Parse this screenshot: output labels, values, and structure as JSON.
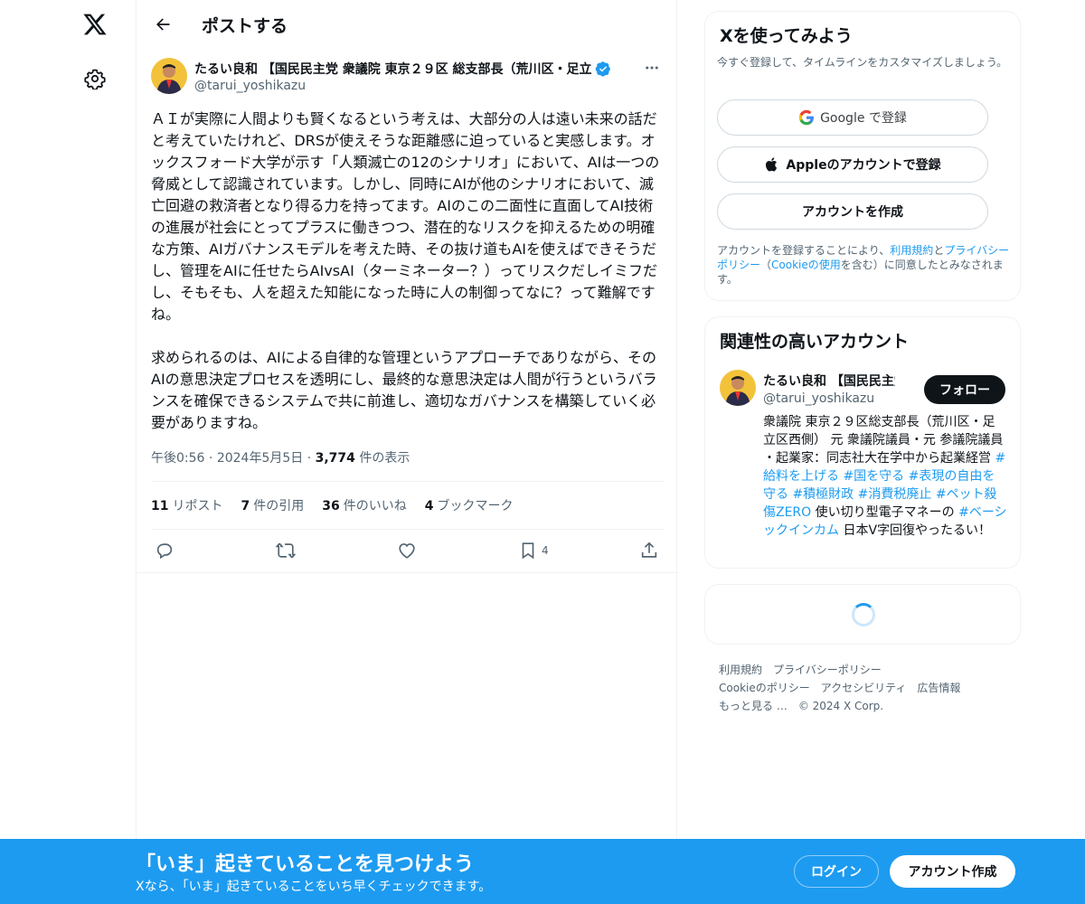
{
  "nav": {
    "logo_icon": "x-logo-icon",
    "settings_icon": "gear-icon"
  },
  "header": {
    "title": "ポストする"
  },
  "tweet": {
    "author_name": "たるい良和 【国民民主党 衆議院 東京２９区 総支部長（荒川区・足立",
    "author_handle": "@tarui_yoshikazu",
    "text": "ＡＩが実際に人間よりも賢くなるという考えは、大部分の人は遠い未来の話だと考えていたけれど、DRSが使えそうな距離感に迫っていると実感します。オックスフォード大学が示す「人類滅亡の12のシナリオ」において、AIは一つの脅威として認識されています。しかし、同時にAIが他のシナリオにおいて、滅亡回避の救済者となり得る力を持ってます。AIのこの二面性に直面してAI技術の進展が社会にとってプラスに働きつつ、潜在的なリスクを抑えるための明確な方策、AIガバナンスモデルを考えた時、その抜け道もAIを使えばできそうだし、管理をAIに任せたらAIvsAI（ターミネーター？）ってリスクだしイミフだし、そもそも、人を超えた知能になった時に人の制御ってなに？って難解ですね。\n\n求められるのは、AIによる自律的な管理というアプローチでありながら、そのAIの意思決定プロセスを透明にし、最終的な意思決定は人間が行うというバランスを確保できるシステムで共に前進し、適切なガバナンスを構築していく必要がありますね。",
    "time": "午後0:56",
    "date": "2024年5月5日",
    "views_count": "3,774",
    "views_label": "件の表示",
    "stats": {
      "reposts_count": "11",
      "reposts_label": "リポスト",
      "quotes_count": "7",
      "quotes_label": "件の引用",
      "likes_count": "36",
      "likes_label": "件のいいね",
      "bookmarks_count": "4",
      "bookmarks_label": "ブックマーク"
    },
    "bookmark_action_count": "4"
  },
  "signup_card": {
    "title": "Xを使ってみよう",
    "subtitle": "今すぐ登録して、タイムラインをカスタマイズしましょう。",
    "google_label": "Google で登録",
    "apple_label": "Appleのアカウントで登録",
    "create_label": "アカウントを作成",
    "terms_prefix": "アカウントを登録することにより、",
    "terms_link": "利用規約",
    "terms_and": "と",
    "privacy_link": "プライバシーポリシー",
    "cookie_open": "（",
    "cookie_link": "Cookieの使用",
    "cookie_rest": "を含む）に同意したとみなされます。"
  },
  "related_card": {
    "title": "関連性の高いアカウント",
    "name": "たるい良和 【国民民主党",
    "handle": "@tarui_yoshikazu",
    "follow_label": "フォロー",
    "bio_text": "衆議院 東京２９区総支部長（荒川区・足立区西側） 元 衆議院議員・元 参議院議員 ・起業家：同志社大在学中から起業経営 ",
    "bio_tag1": "#給料を上げる",
    "bio_tag2": "#国を守る",
    "bio_tag3": "#表現の自由を守る",
    "bio_tag4": "#積極財政",
    "bio_tag5": "#消費税廃止",
    "bio_tag6": "#ペット殺傷ZERO",
    "bio_mid": " 使い切り型電子マネーの ",
    "bio_tag7": "#ベーシックインカム",
    "bio_end": " 日本V字回復やったるい！"
  },
  "footer": {
    "terms": "利用規約",
    "privacy": "プライバシーポリシー",
    "cookie": "Cookieのポリシー",
    "accessibility": "アクセシビリティ",
    "ads": "広告情報",
    "more": "もっと見る …",
    "copyright": "© 2024 X Corp."
  },
  "bottom_bar": {
    "title": "「いま」起きていることを見つけよう",
    "subtitle": "Xなら、「いま」起きていることをいち早くチェックできます。",
    "login_label": "ログイン",
    "signup_label": "アカウント作成"
  },
  "colors": {
    "accent": "#1d9bf0",
    "text": "#0f1419",
    "muted": "#536471"
  }
}
